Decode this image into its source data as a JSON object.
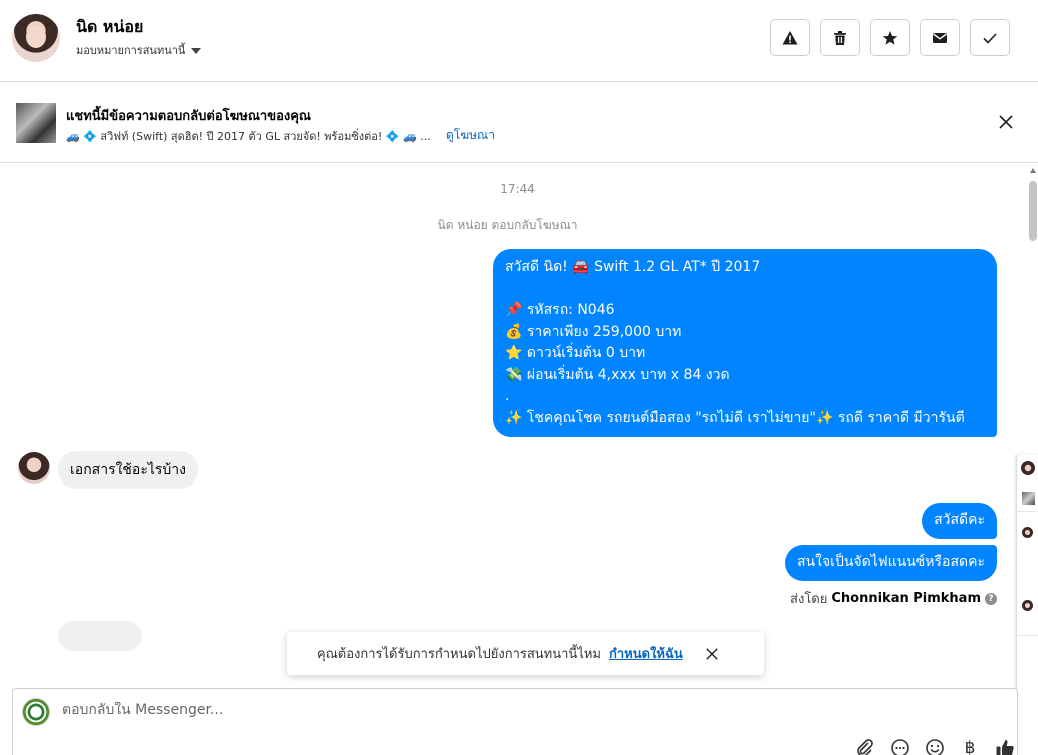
{
  "header": {
    "contact_name": "นิด หน่อย",
    "assign_label": "มอบหมายการสนทนานี้",
    "actions": [
      {
        "name": "report-button",
        "icon": "warning-icon"
      },
      {
        "name": "delete-button",
        "icon": "trash-icon"
      },
      {
        "name": "star-button",
        "icon": "star-icon"
      },
      {
        "name": "mark-unread-button",
        "icon": "envelope-icon"
      },
      {
        "name": "mark-done-button",
        "icon": "check-icon"
      }
    ]
  },
  "ad_banner": {
    "title": "แชทนี้มีข้อความตอบกลับต่อโฆษณาของคุณ",
    "description": "🚙 💠 สวิฟท์ (Swift) สุดฮิต! ปี 2017 ตัว GL สวยจัด! พร้อมซิ่งต่อ! 💠 🚙 ...",
    "link": "ดูโฆษณา"
  },
  "chat": {
    "timestamp": "17:44",
    "system_note": "นิด หน่อย ตอบกลับโฆษณา",
    "outgoing_ad_message": [
      "สวัสดี นิด! 🚘 Swift 1.2 GL AT* ปี 2017",
      "",
      "📌 รหัสรถ: N046",
      "💰 ราคาเพียง 259,000 บาท",
      "⭐ ดาวน์เริ่มต้น 0 บาท",
      "💸 ผ่อนเริ่มต้น 4,xxx บาท x 84 งวด",
      ".",
      "✨ โชคคุณโชค รถยนต์มือสอง \"รถไม่ดี เราไม่ขาย\"✨ รถดี ราคาดี มีวารันตี"
    ],
    "incoming_message": "เอกสารใช้อะไรบ้าง",
    "reply_1": "สวัสดีคะ",
    "reply_2": "สนใจเป็นจัดไฟแนนซ์หรือสดคะ",
    "sent_by_prefix": "ส่งโดย",
    "sent_by_name": "Chonnikan Pimkham"
  },
  "toast": {
    "text": "คุณต้องการได้รับการกำหนดไปยังการสนทนานี้ไหม",
    "link": "กำหนดให้ฉัน"
  },
  "composer": {
    "placeholder": "ตอบกลับใน Messenger...",
    "currency_symbol": "฿"
  },
  "colors": {
    "outgoing_bubble": "#0084ff",
    "incoming_bubble": "#f0f0f0",
    "link": "#0a66c2"
  }
}
